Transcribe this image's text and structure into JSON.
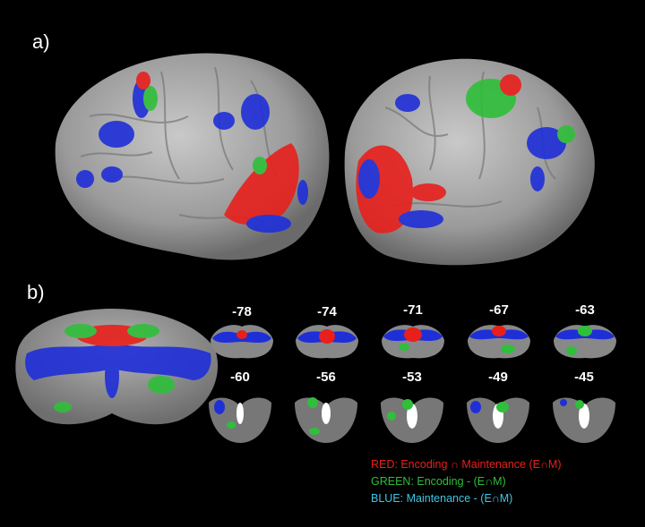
{
  "panels": {
    "a": {
      "label": "a)"
    },
    "b": {
      "label": "b)"
    }
  },
  "slices": [
    "-78",
    "-74",
    "-71",
    "-67",
    "-63",
    "-60",
    "-56",
    "-53",
    "-49",
    "-45"
  ],
  "legend": {
    "red": "RED: Encoding ∩ Maintenance (E∩M)",
    "green": "GREEN: Encoding - (E∩M)",
    "blue": "BLUE: Maintenance - (E∩M)"
  },
  "colors": {
    "red": "#e8201c",
    "green": "#2fbf3a",
    "blue": "#1f2fd8",
    "cyan_text": "#3fc6e6",
    "brain": "#9a9a9a"
  }
}
